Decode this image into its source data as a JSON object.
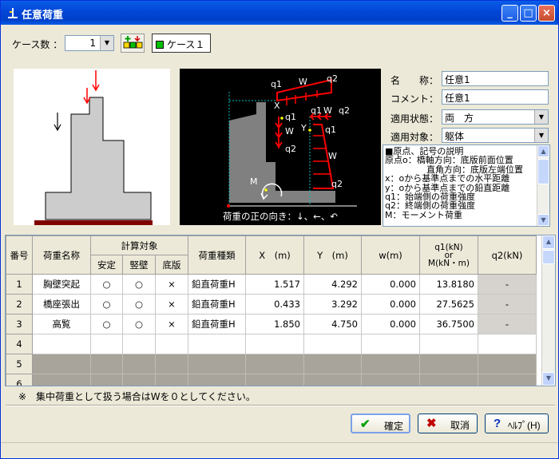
{
  "window": {
    "title": "任意荷重"
  },
  "toolbar": {
    "case_count_label": "ケース数 ：",
    "case_count_value": "1",
    "case_name": "ケース１"
  },
  "diagram": {
    "caption": "荷重の正の向き：↓、←、↶",
    "labels": {
      "q1": "q1",
      "q2": "q2",
      "w": "W",
      "x": "X",
      "y": "Y",
      "m": "M"
    },
    "colors": {
      "load": "#ff0000",
      "structure": "#808080",
      "guide": "#00c0c0",
      "bg": "#000000"
    }
  },
  "properties": {
    "name_label": "名　　称：",
    "name_value": "任意1",
    "comment_label": "コメント：",
    "comment_value": "任意1",
    "state_label": "適用状態：",
    "state_value": "両　方",
    "target_label": "適用対象：",
    "target_value": "躯体"
  },
  "legend": {
    "lines": [
      "■原点、記号の説明",
      "原点o：橋軸方向：底版前面位置",
      "直角方向：底版左端位置",
      "x：oから基準点までの水平距離",
      "y：oから基準点までの鉛直距離",
      "q1：始端側の荷重強度",
      "q2：終端側の荷重強度",
      "M：モーメント荷重"
    ]
  },
  "grid": {
    "headers": {
      "no": "番号",
      "name": "荷重名称",
      "target": "計算対象",
      "stable": "安定",
      "wall": "竪壁",
      "base": "底版",
      "type": "荷重種類",
      "x": "X　(m)",
      "y": "Y　(m)",
      "w": "w(m)",
      "q1_l1": "q1(kN)",
      "q1_l2": "or",
      "q1_l3": "M(kN・m)",
      "q2": "q2(kN)"
    },
    "rows": [
      {
        "no": "1",
        "name": "胸壁突起",
        "stable": "○",
        "wall": "○",
        "base": "×",
        "type": "鉛直荷重H",
        "x": "1.517",
        "y": "4.292",
        "w": "0.000",
        "q1": "13.8180",
        "q2": "-"
      },
      {
        "no": "2",
        "name": "橋座張出",
        "stable": "○",
        "wall": "○",
        "base": "×",
        "type": "鉛直荷重H",
        "x": "0.433",
        "y": "3.292",
        "w": "0.000",
        "q1": "27.5625",
        "q2": "-"
      },
      {
        "no": "3",
        "name": "高覧",
        "stable": "○",
        "wall": "○",
        "base": "×",
        "type": "鉛直荷重H",
        "x": "1.850",
        "y": "4.750",
        "w": "0.000",
        "q1": "36.7500",
        "q2": "-"
      },
      {
        "no": "4"
      },
      {
        "no": "5"
      },
      {
        "no": "6"
      }
    ]
  },
  "note": "※　集中荷重として扱う場合はWを０としてください。",
  "buttons": {
    "ok": "確定",
    "cancel": "取消",
    "help": "ﾍﾙﾌﾟ(H)"
  },
  "colors": {
    "titlebar": "#0346d7",
    "face": "#ece9d8",
    "disabled_row": "#a8a49c"
  }
}
